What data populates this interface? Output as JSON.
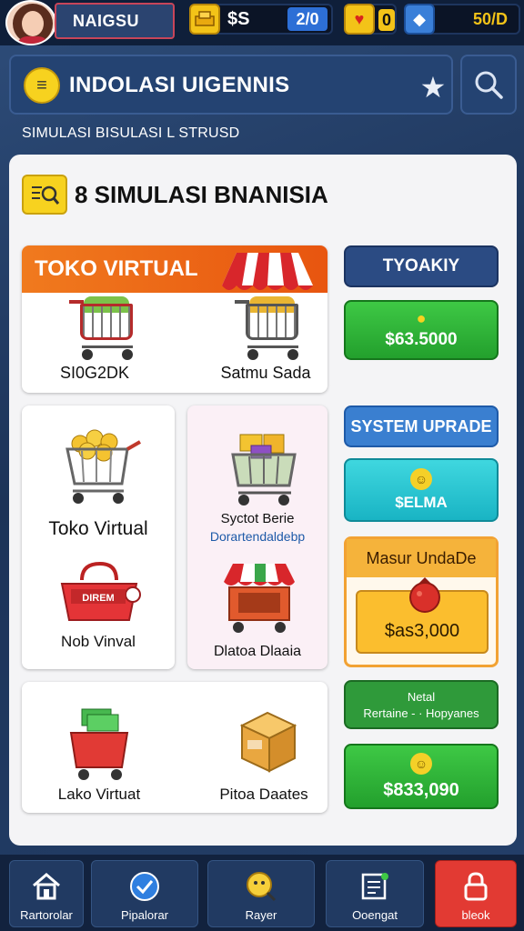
{
  "header": {
    "player_name": "NAIGSU",
    "resources": [
      {
        "icon": "gold-bars-icon",
        "label": "$S",
        "value": "2/0"
      },
      {
        "icon": "heart-icon",
        "value": "0"
      },
      {
        "icon": "gem-icon",
        "value": "50/D"
      }
    ]
  },
  "title_bar": {
    "title": "INDOLASI UIGENNIS",
    "favorite_icon": "star-icon",
    "search_icon": "search-icon"
  },
  "subtitle": "SIMULASI BISULASI L STRUSD",
  "panel": {
    "heading": "8 SIMULASI BNANISIA",
    "toko_card": {
      "header": "TOKO VIRTUAL",
      "items": [
        "SI0G2DK",
        "Satmu Sada"
      ]
    },
    "card_a": {
      "title": "Toko Virtual",
      "secondary": "Nob Vinval",
      "basket_sign": "DIREM"
    },
    "card_b": {
      "title": "Syctot Berie",
      "subtitle": "Dorartendaldebp",
      "secondary": "Dlatoa Dlaaia"
    },
    "card_c": {
      "items": [
        "Lako Virtuat",
        "Pitoa Daates"
      ]
    }
  },
  "sidebar": {
    "tab_label": "TYOAKIY",
    "price_1": "$63.5000",
    "system_upgrade": "SYSTEM UPRADE",
    "teal_price": "$ELMA",
    "masuk_title": "Masur UndaDe",
    "masuk_price": "$as3,000",
    "info_line1": "Netal",
    "info_line2": "Rertaine - · Hopyanes",
    "price_2": "$833,090"
  },
  "bottom_nav": [
    {
      "label": "Rartorolar",
      "icon": "home-icon"
    },
    {
      "label": "Pipalorar",
      "icon": "check-circle-icon"
    },
    {
      "label": "Rayer",
      "icon": "magnify-face-icon"
    },
    {
      "label": "Ooengat",
      "icon": "document-icon"
    },
    {
      "label": "bleok",
      "icon": "lock-icon"
    }
  ]
}
